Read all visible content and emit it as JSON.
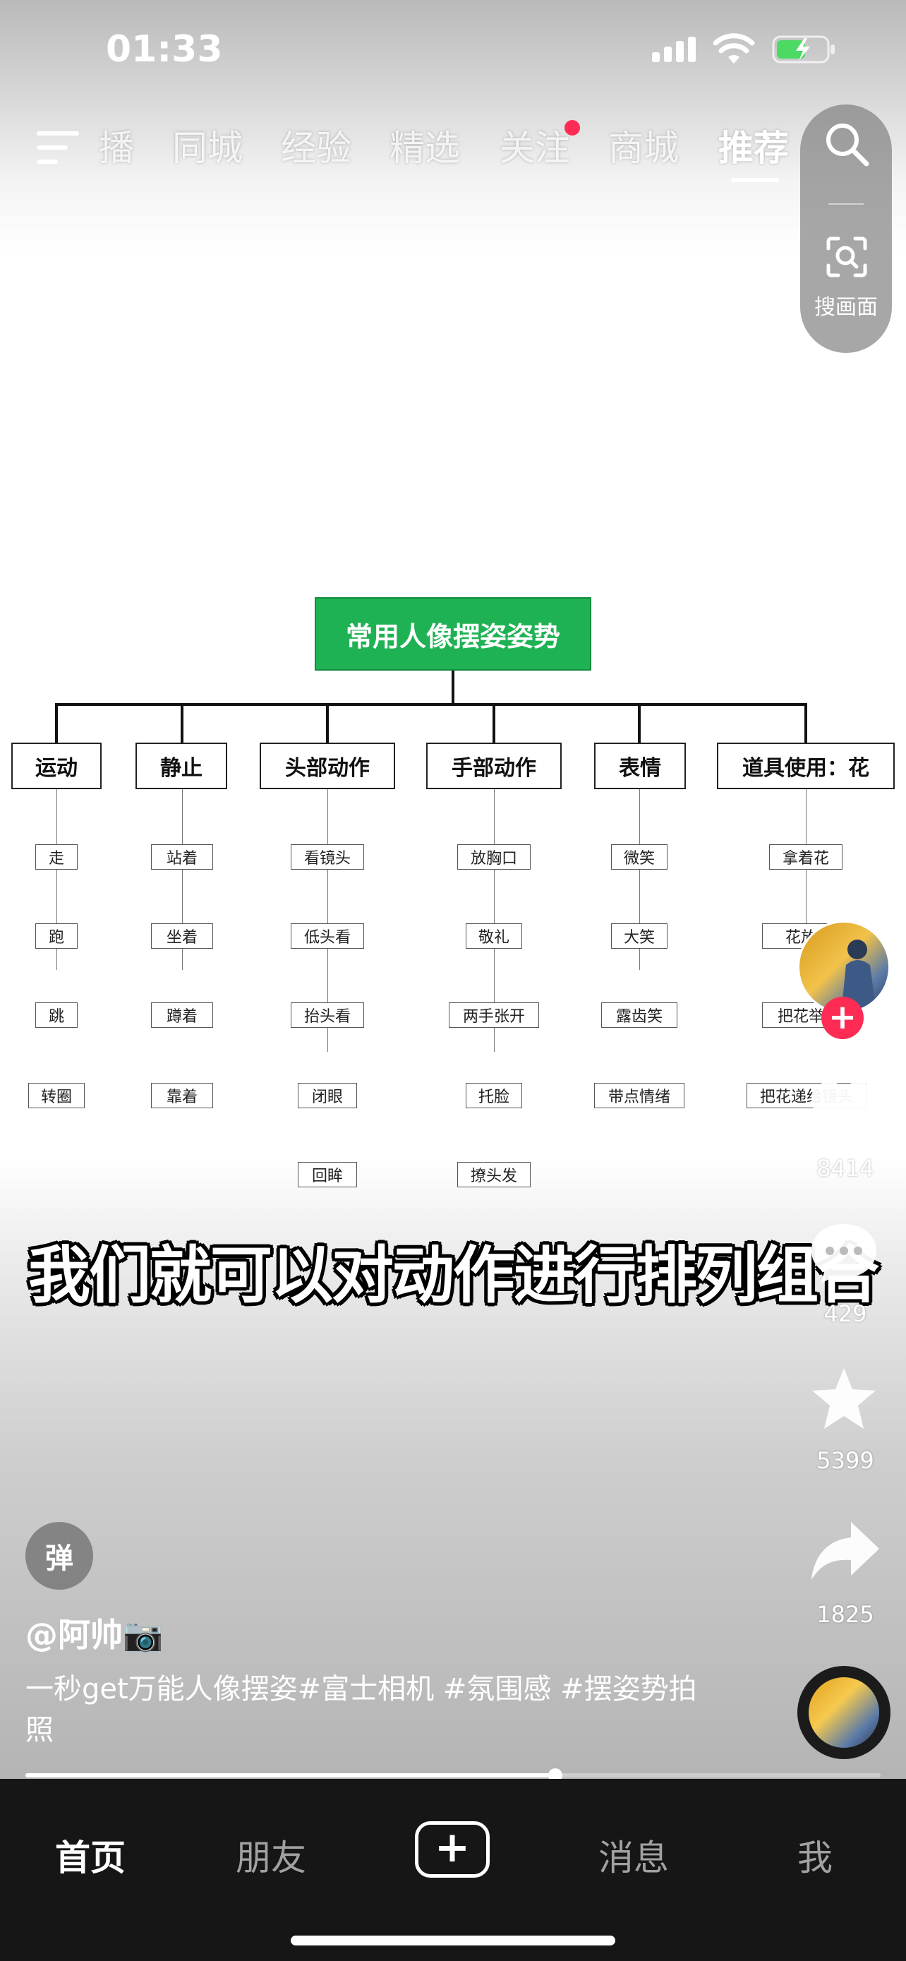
{
  "status": {
    "time": "01:33"
  },
  "topnav": {
    "tabs": [
      "播",
      "同城",
      "经验",
      "精选",
      "关注",
      "商城",
      "推荐"
    ],
    "active": "推荐",
    "scan_label": "搜画面"
  },
  "diagram": {
    "root": "常用人像摆姿姿势",
    "categories": [
      {
        "label": "运动",
        "items": [
          "走",
          "跑",
          "跳",
          "转圈"
        ]
      },
      {
        "label": "静止",
        "items": [
          "站着",
          "坐着",
          "蹲着",
          "靠着"
        ]
      },
      {
        "label": "头部动作",
        "items": [
          "看镜头",
          "低头看",
          "抬头看",
          "闭眼",
          "回眸"
        ]
      },
      {
        "label": "手部动作",
        "items": [
          "放胸口",
          "敬礼",
          "两手张开",
          "托脸",
          "撩头发"
        ]
      },
      {
        "label": "表情",
        "items": [
          "微笑",
          "大笑",
          "露齿笑",
          "带点情绪"
        ]
      },
      {
        "label": "道具使用：花",
        "items": [
          "拿着花",
          "花放",
          "把花举",
          "把花递给镜头"
        ]
      }
    ]
  },
  "subtitle": "我们就可以对动作进行排列组合",
  "rail": {
    "like_count": "8414",
    "comment_count": "429",
    "favorite_count": "5399",
    "share_count": "1825"
  },
  "info": {
    "danmu_label": "弹",
    "author": "@阿帅📷",
    "description": "一秒get万能人像摆姿#富士相机 #氛围感 #摆姿势拍照",
    "progress": 0.62
  },
  "tabbar": {
    "home": "首页",
    "friends": "朋友",
    "messages": "消息",
    "me": "我"
  },
  "colors": {
    "accent": "#fe2c55",
    "diagram_root": "#1fb254"
  }
}
